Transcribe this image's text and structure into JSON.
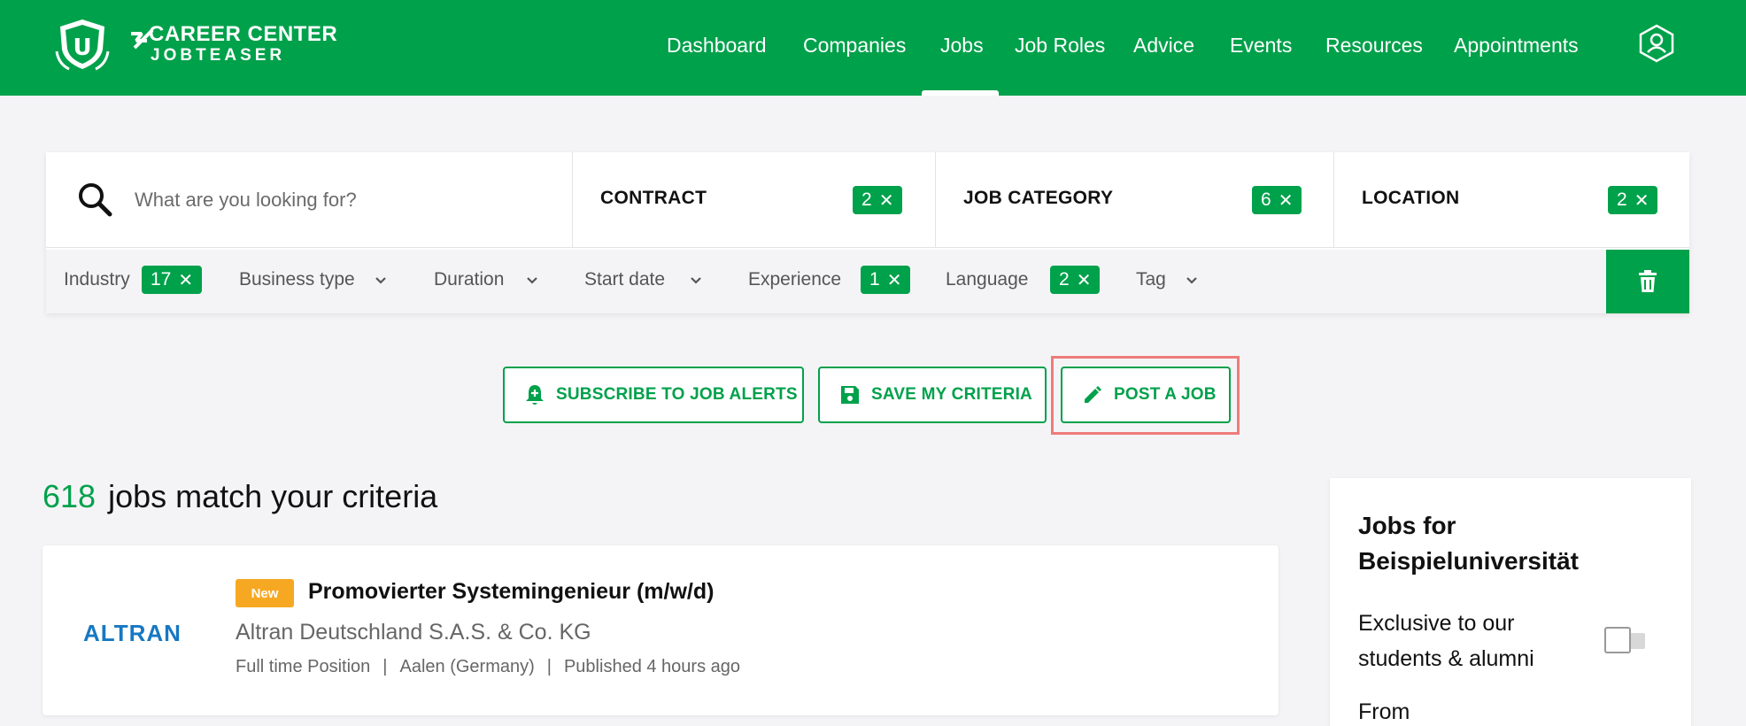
{
  "header": {
    "logo_line1": "CAREER CENTER",
    "logo_line2": "JOBTEASER",
    "nav": [
      "Dashboard",
      "Companies",
      "Jobs",
      "Job Roles",
      "Advice",
      "Events",
      "Resources",
      "Appointments"
    ],
    "active_nav": "Jobs",
    "brand_color": "#00a14b"
  },
  "search": {
    "placeholder": "What are you looking for?",
    "filters": [
      {
        "label": "CONTRACT",
        "count": "2"
      },
      {
        "label": "JOB CATEGORY",
        "count": "6"
      },
      {
        "label": "LOCATION",
        "count": "2"
      }
    ]
  },
  "subfilters": {
    "industry": {
      "label": "Industry",
      "count": "17"
    },
    "business_type": {
      "label": "Business type"
    },
    "duration": {
      "label": "Duration"
    },
    "start_date": {
      "label": "Start date"
    },
    "experience": {
      "label": "Experience",
      "count": "1"
    },
    "language": {
      "label": "Language",
      "count": "2"
    },
    "tag": {
      "label": "Tag"
    }
  },
  "actions": {
    "subscribe": "SUBSCRIBE TO JOB ALERTS",
    "save": "SAVE MY CRITERIA",
    "post": "POST A JOB"
  },
  "results": {
    "count": "618",
    "count_text": "jobs match your criteria"
  },
  "job": {
    "company_logo": "ALTRAN",
    "badge": "New",
    "title": "Promovierter Systemingenieur (m/w/d)",
    "company": "Altran Deutschland S.A.S. & Co. KG",
    "type": "Full time Position",
    "location": "Aalen (Germany)",
    "published": "Published 4 hours ago"
  },
  "sidebar": {
    "title": "Jobs for Beispieluniversität",
    "exclusive": "Exclusive to our students & alumni",
    "from": "From"
  }
}
